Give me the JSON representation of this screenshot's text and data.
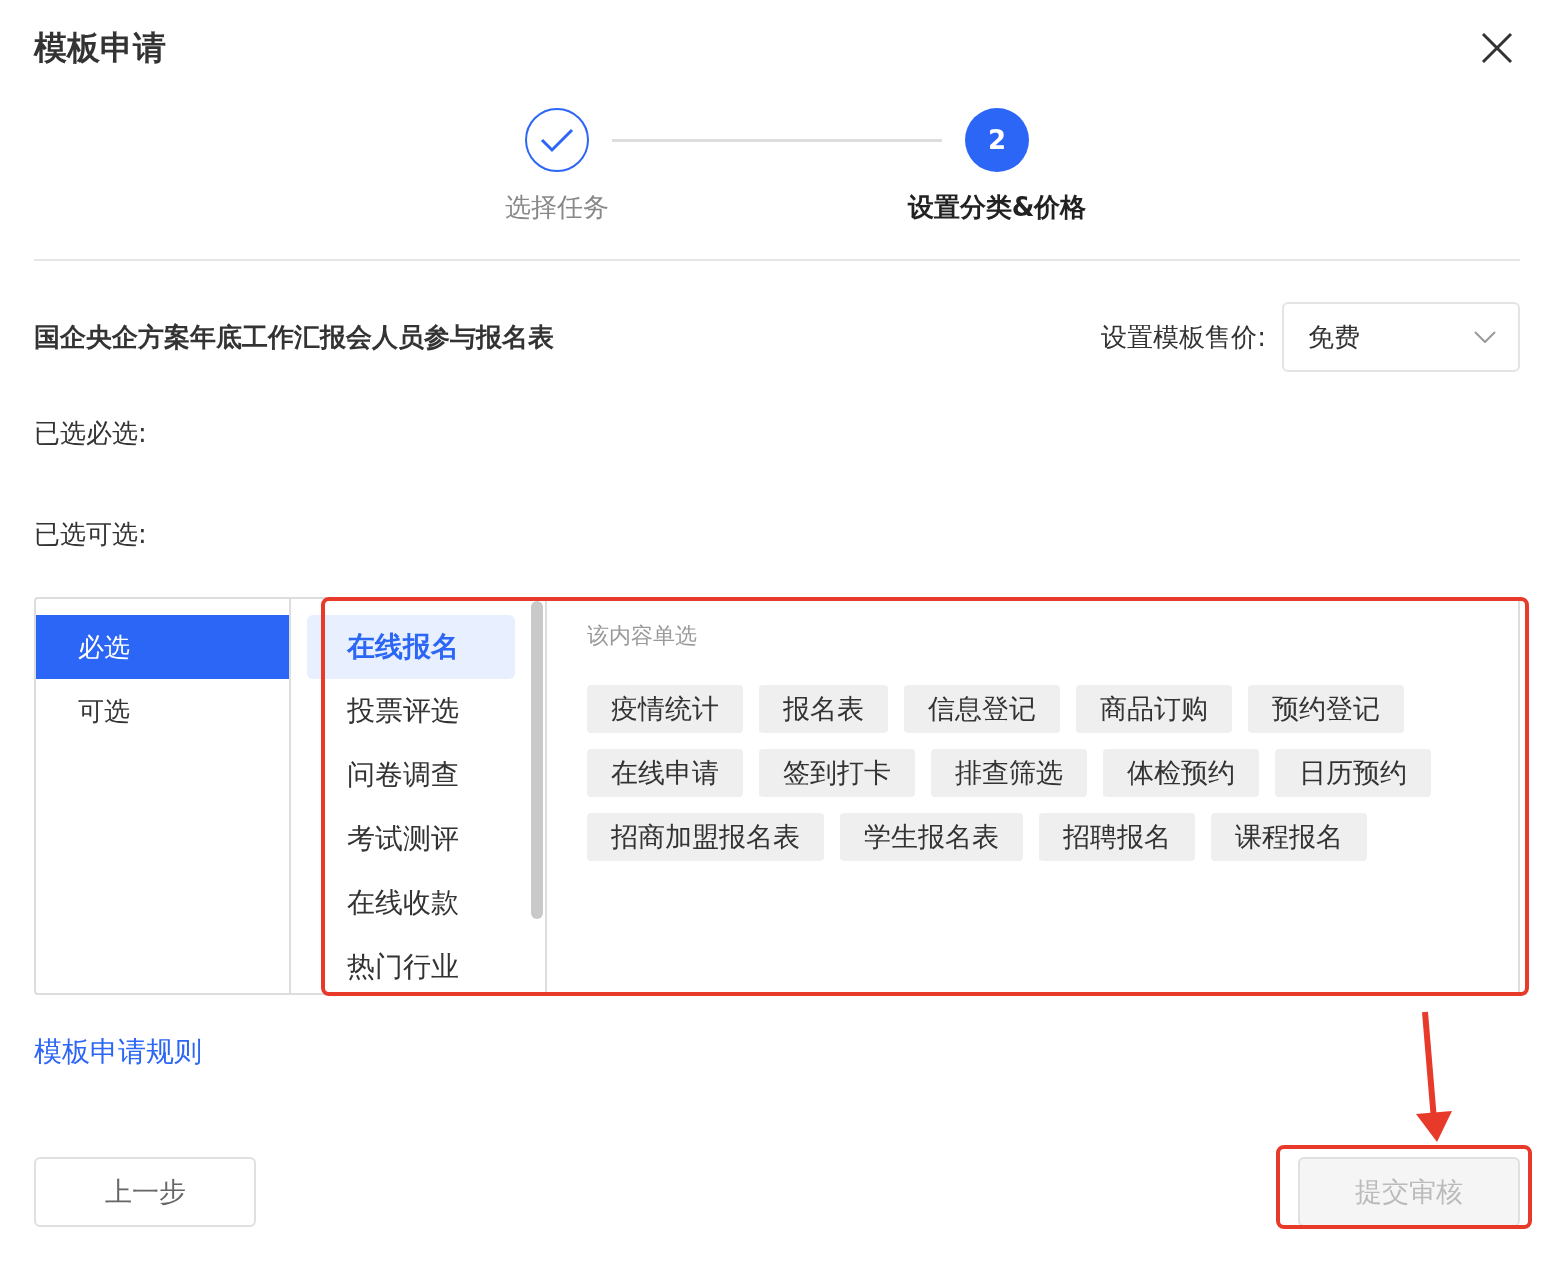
{
  "dialog": {
    "title": "模板申请"
  },
  "steps": [
    {
      "label": "选择任务",
      "kind": "done",
      "selected": false
    },
    {
      "label": "设置分类&价格",
      "kind": "number",
      "number": "2",
      "selected": true
    }
  ],
  "template_name": "国企央企方案年底工作汇报会人员参与报名表",
  "price": {
    "label": "设置模板售价:",
    "value": "免费"
  },
  "selected_required": "已选必选:",
  "selected_optional": "已选可选:",
  "categories": [
    {
      "label": "必选",
      "selected": true
    },
    {
      "label": "可选",
      "selected": false
    }
  ],
  "subcategories": [
    {
      "label": "在线报名",
      "selected": true
    },
    {
      "label": "投票评选",
      "selected": false
    },
    {
      "label": "问卷调查",
      "selected": false
    },
    {
      "label": "考试测评",
      "selected": false
    },
    {
      "label": "在线收款",
      "selected": false
    },
    {
      "label": "热门行业",
      "selected": false
    }
  ],
  "tags_hint": "该内容单选",
  "tags": [
    "疫情统计",
    "报名表",
    "信息登记",
    "商品订购",
    "预约登记",
    "在线申请",
    "签到打卡",
    "排查筛选",
    "体检预约",
    "日历预约",
    "招商加盟报名表",
    "学生报名表",
    "招聘报名",
    "课程报名"
  ],
  "rules_link": "模板申请规则",
  "back_button": "上一步",
  "submit_button": {
    "label": "提交审核",
    "disabled": true
  }
}
